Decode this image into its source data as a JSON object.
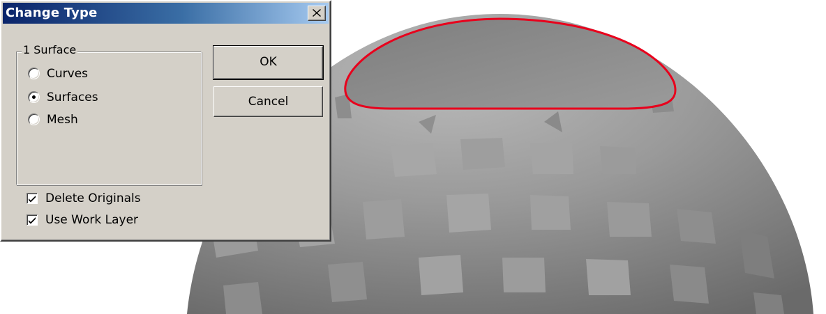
{
  "dialog": {
    "title": "Change Type",
    "close_icon": "close-x-icon",
    "group": {
      "label": "1 Surface",
      "options": [
        {
          "label": "Curves",
          "selected": false
        },
        {
          "label": "Surfaces",
          "selected": true
        },
        {
          "label": "Mesh",
          "selected": false
        }
      ]
    },
    "checkboxes": [
      {
        "label": "Delete Originals",
        "checked": true
      },
      {
        "label": "Use Work Layer",
        "checked": true
      }
    ],
    "buttons": {
      "ok": "OK",
      "cancel": "Cancel"
    }
  },
  "colors": {
    "title_bar_start": "#0a246a",
    "title_bar_end": "#a6caf0",
    "dialog_face": "#d4d0c8",
    "selection_outline": "#e8001c",
    "sphere_gray": "#8a8a8a"
  }
}
